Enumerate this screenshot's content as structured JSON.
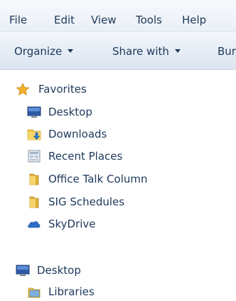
{
  "menu": [
    "File",
    "Edit",
    "View",
    "Tools",
    "Help"
  ],
  "toolbar": {
    "organize": "Organize",
    "share": "Share with",
    "burn": "Bur"
  },
  "nav": {
    "favorites": {
      "label": "Favorites",
      "icon": "star-icon",
      "items": [
        {
          "label": "Desktop",
          "icon": "desktop-icon"
        },
        {
          "label": "Downloads",
          "icon": "downloads-folder-icon"
        },
        {
          "label": "Recent Places",
          "icon": "recent-places-icon"
        },
        {
          "label": "Office Talk Column",
          "icon": "folder-icon"
        },
        {
          "label": "SIG Schedules",
          "icon": "folder-icon"
        },
        {
          "label": "SkyDrive",
          "icon": "skydrive-icon"
        }
      ]
    },
    "desktop": {
      "label": "Desktop",
      "icon": "desktop-icon",
      "items": [
        {
          "label": "Libraries",
          "icon": "libraries-icon"
        }
      ]
    }
  },
  "colors": {
    "text": "#1e395b",
    "star": "#f2b32a",
    "folder": "#f0c64a",
    "skydrive": "#2a6ec6"
  }
}
